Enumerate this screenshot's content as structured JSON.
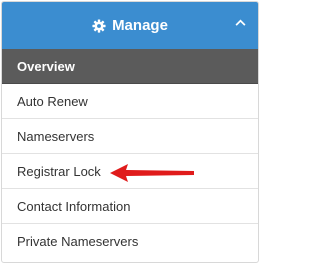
{
  "panel": {
    "title": "Manage",
    "title_icon": "gear-icon",
    "collapse_icon": "chevron-up-icon",
    "accent_color": "#3b8dd0",
    "active_item_bg": "#5b5b5b"
  },
  "menu": {
    "items": [
      {
        "label": "Overview",
        "active": true
      },
      {
        "label": "Auto Renew",
        "active": false
      },
      {
        "label": "Nameservers",
        "active": false
      },
      {
        "label": "Registrar Lock",
        "active": false
      },
      {
        "label": "Contact Information",
        "active": false
      },
      {
        "label": "Private Nameservers",
        "active": false
      }
    ]
  },
  "annotation": {
    "icon": "red-arrow-icon",
    "color": "#e01b1b",
    "points_to": "Registrar Lock"
  }
}
